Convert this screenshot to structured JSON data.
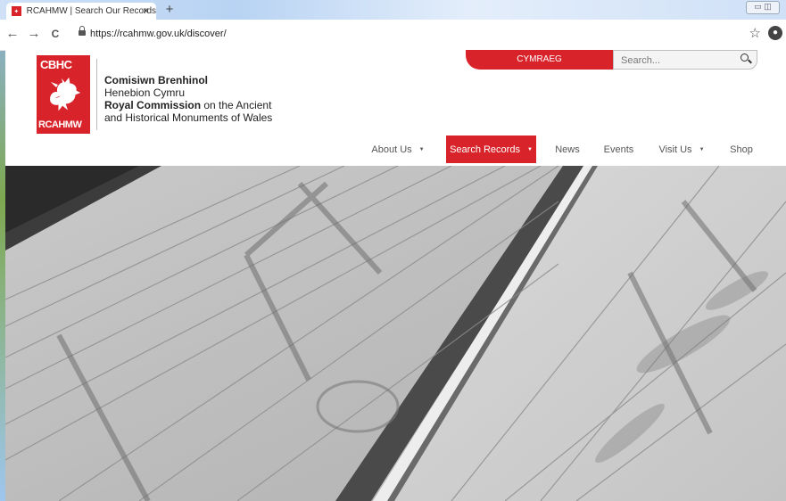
{
  "browser": {
    "tab_title": "RCAHMW | Search Our Records",
    "tab_close": "×",
    "new_tab": "+",
    "url": "https://rcahmw.gov.uk/discover/",
    "back_icon": "←",
    "forward_icon": "→",
    "reload_icon": "C",
    "star_icon": "☆",
    "profile_icon": "person"
  },
  "logo": {
    "top": "CBHC",
    "bottom": "RCAHMW",
    "color": "#d8232a"
  },
  "org": {
    "line1": "Comisiwn Brenhinol",
    "line2": "Henebion Cymru",
    "line3_bold": "Royal Commission",
    "line3_rest": " on the Ancient",
    "line4": "and Historical Monuments of Wales"
  },
  "header": {
    "language": "CYMRAEG",
    "search_placeholder": "Search..."
  },
  "nav": {
    "about": "About Us",
    "search_records": "Search Records",
    "news": "News",
    "events": "Events",
    "visit": "Visit Us",
    "shop": "Shop",
    "caret": "▼"
  },
  "colors": {
    "accent": "#d8232a"
  }
}
